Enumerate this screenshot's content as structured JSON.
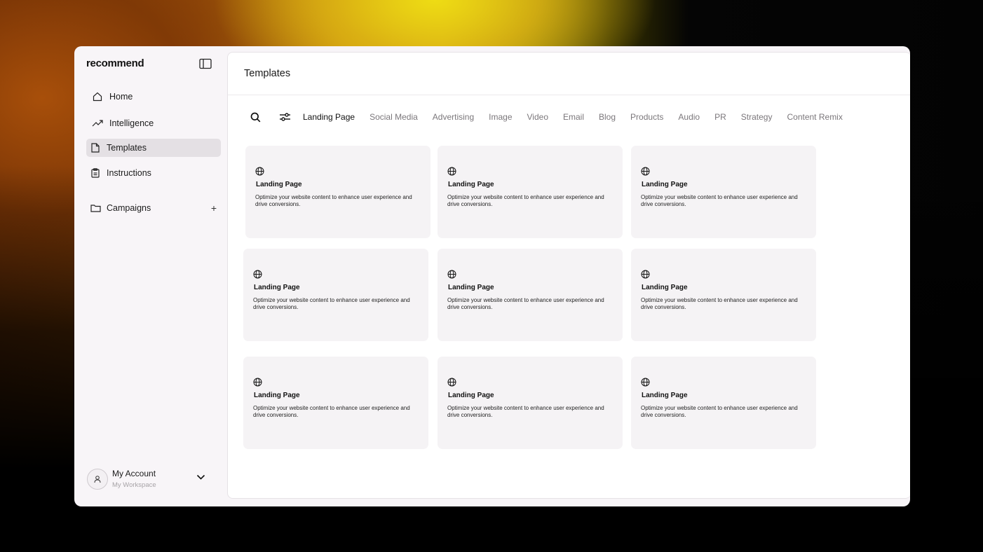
{
  "app": {
    "name": "recommend"
  },
  "sidebar": {
    "items": [
      {
        "label": "Home",
        "icon": "home-icon"
      },
      {
        "label": "Intelligence",
        "icon": "trending-icon"
      },
      {
        "label": "Templates",
        "icon": "file-icon",
        "active": true
      },
      {
        "label": "Instructions",
        "icon": "clipboard-icon"
      },
      {
        "label": "Campaigns",
        "icon": "folder-icon"
      }
    ],
    "add_label": "+"
  },
  "account": {
    "name": "My Account",
    "workspace": "My Workspace"
  },
  "page": {
    "title": "Templates"
  },
  "tabs": [
    "Landing Page",
    "Social Media",
    "Advertising",
    "Image",
    "Video",
    "Email",
    "Blog",
    "Products",
    "Audio",
    "PR",
    "Strategy",
    "Content Remix"
  ],
  "active_tab": "Landing Page",
  "cards": [
    {
      "title": "Landing Page",
      "desc": "Optimize your website content to enhance user experience and drive conversions.",
      "icon": "globe-icon"
    },
    {
      "title": "Landing Page",
      "desc": "Optimize your website content to enhance user experience and drive conversions.",
      "icon": "globe-icon"
    },
    {
      "title": "Landing Page",
      "desc": "Optimize your website content to enhance user experience and drive conversions.",
      "icon": "globe-icon"
    },
    {
      "title": "Landing Page",
      "desc": "Optimize your website content to enhance user experience and drive conversions.",
      "icon": "globe-icon"
    },
    {
      "title": "Landing Page",
      "desc": "Optimize your website content to enhance user experience and drive conversions.",
      "icon": "globe-icon"
    },
    {
      "title": "Landing Page",
      "desc": "Optimize your website content to enhance user experience and drive conversions.",
      "icon": "globe-icon"
    },
    {
      "title": "Landing Page",
      "desc": "Optimize your website content to enhance user experience and drive conversions.",
      "icon": "globe-icon"
    },
    {
      "title": "Landing Page",
      "desc": "Optimize your website content to enhance user experience and drive conversions.",
      "icon": "globe-icon"
    },
    {
      "title": "Landing Page",
      "desc": "Optimize your website content to enhance user experience and drive conversions.",
      "icon": "globe-icon"
    }
  ]
}
